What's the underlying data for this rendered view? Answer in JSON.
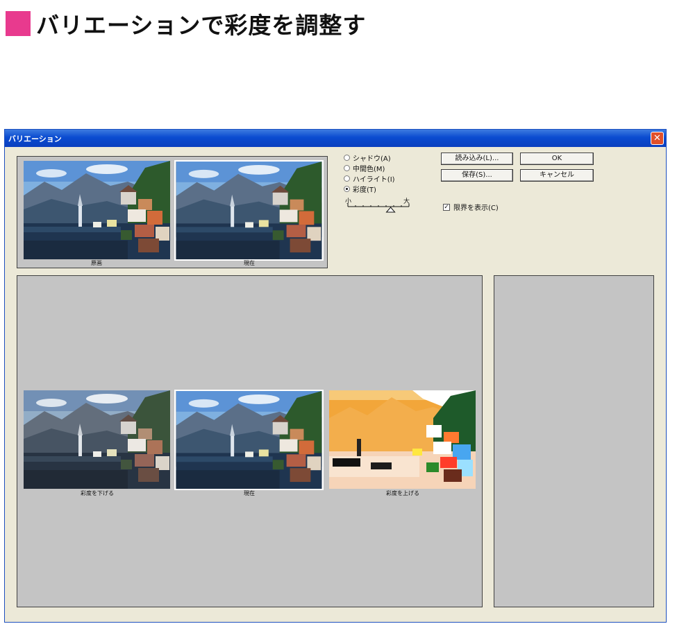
{
  "heading": {
    "title": "バリエーションで彩度を調整す"
  },
  "window": {
    "title": "バリエーション",
    "close_glyph": "✕"
  },
  "top_thumbs": {
    "original_caption": "原画",
    "current_caption": "現在"
  },
  "mode_radios": [
    {
      "label": "シャドウ(A)",
      "selected": false
    },
    {
      "label": "中間色(M)",
      "selected": false
    },
    {
      "label": "ハイライト(I)",
      "selected": false
    },
    {
      "label": "彩度(T)",
      "selected": true
    }
  ],
  "slider": {
    "min_label": "小",
    "max_label": "大",
    "level": 0.7
  },
  "buttons": {
    "load": "読み込み(L)...",
    "ok": "OK",
    "save": "保存(S)...",
    "cancel": "キャンセル"
  },
  "show_clipping": {
    "label": "限界を表示(C)",
    "checked": true
  },
  "variations": {
    "less": "彩度を下げる",
    "current": "現在",
    "more": "彩度を上げる"
  },
  "colors": {
    "accent": "#e83a8e",
    "titlebar": "#0a4bd0",
    "dialog_bg": "#ece9d8",
    "panel_bg": "#c4c4c4"
  }
}
